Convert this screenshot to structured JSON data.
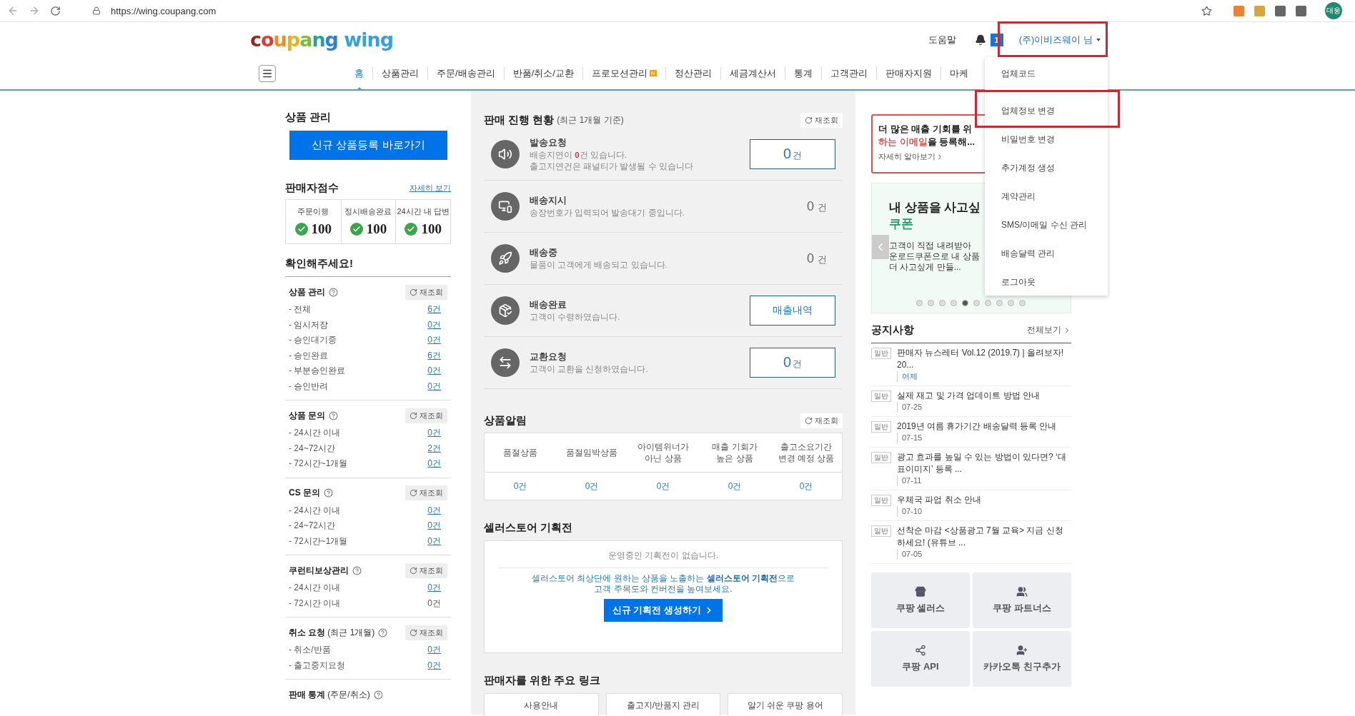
{
  "browser": {
    "url": "https://wing.coupang.com",
    "avatar": "대웅"
  },
  "header": {
    "logo": {
      "brand": "coupang",
      "product": "wing"
    },
    "help": "도움말",
    "notification_count": "1",
    "user": "(주)이비즈웨이 님"
  },
  "nav": [
    {
      "label": "홈",
      "selected": true
    },
    {
      "label": "상품관리",
      "selected": false
    },
    {
      "label": "주문/배송관리",
      "selected": false
    },
    {
      "label": "반품/취소/교환",
      "selected": false
    },
    {
      "label": "프로모션관리",
      "selected": false,
      "badge": "N"
    },
    {
      "label": "정산관리",
      "selected": false
    },
    {
      "label": "세금계산서",
      "selected": false
    },
    {
      "label": "통계",
      "selected": false
    },
    {
      "label": "고객관리",
      "selected": false
    },
    {
      "label": "판매자지원",
      "selected": false
    },
    {
      "label": "마케",
      "selected": false
    }
  ],
  "account_menu": [
    "업체코드",
    "업체정보 변경",
    "비밀번호 변경",
    "추가계정 생성",
    "계약관리",
    "SMS/이메일 수신 관리",
    "배송달력 관리",
    "로그아웃"
  ],
  "left": {
    "product_title": "상품 관리",
    "register_button": "신규 상품등록 바로가기",
    "score": {
      "title": "판매자점수",
      "link": "자세히 보기",
      "metrics": [
        {
          "label": "주문이행",
          "value": "100"
        },
        {
          "label": "정시배송완료",
          "value": "100"
        },
        {
          "label": "24시간 내 답변",
          "value": "100"
        }
      ]
    },
    "check_title": "확인해주세요!",
    "sections": [
      {
        "title": "상품 관리",
        "refresh": "재조회",
        "items": [
          {
            "label": "- 전체",
            "count": "6건",
            "link": true
          },
          {
            "label": "- 임시저장",
            "count": "0건",
            "link": true
          },
          {
            "label": "- 승인대기중",
            "count": "0건",
            "link": true
          },
          {
            "label": "- 승인완료",
            "count": "6건",
            "link": true
          },
          {
            "label": "- 부분승인완료",
            "count": "0건",
            "link": true
          },
          {
            "label": "- 승인반려",
            "count": "0건",
            "link": true
          }
        ]
      },
      {
        "title": "상품 문의",
        "refresh": "재조회",
        "items": [
          {
            "label": "- 24시간 이내",
            "count": "0건",
            "link": true
          },
          {
            "label": "- 24~72시간",
            "count": "2건",
            "link": true
          },
          {
            "label": "- 72시간~1개월",
            "count": "0건",
            "link": true
          }
        ]
      },
      {
        "title": "CS 문의",
        "refresh": "재조회",
        "items": [
          {
            "label": "- 24시간 이내",
            "count": "0건",
            "link": true
          },
          {
            "label": "- 24~72시간",
            "count": "0건",
            "link": true
          },
          {
            "label": "- 72시간~1개월",
            "count": "0건",
            "link": true
          }
        ]
      },
      {
        "title": "쿠런티보상관리",
        "refresh": "재조회",
        "items": [
          {
            "label": "- 24시간 이내",
            "count": "0건",
            "link": true
          },
          {
            "label": "- 72시간 이내",
            "count": "0건",
            "link": false
          }
        ]
      },
      {
        "title": "취소 요청",
        "note": "(최근 1개월)",
        "refresh": "재조회",
        "items": [
          {
            "label": "- 취소/반품",
            "count": "0건",
            "link": true
          },
          {
            "label": "- 출고중지요청",
            "count": "0건",
            "link": true
          }
        ]
      },
      {
        "title": "판매 통계",
        "note": "(주문/취소)"
      }
    ]
  },
  "middle": {
    "status": {
      "title": "판매 진행 현황",
      "note": "(최근 1개월 기준)",
      "refresh": "재조회",
      "rows": [
        {
          "kind": "boxed",
          "title": "발송요청",
          "lines": [
            "배송지연이 **0**건 있습니다.",
            "출고지연건은 패널티가 발생될 수 있습니다"
          ],
          "count": "0",
          "unit": "건"
        },
        {
          "kind": "plain",
          "title": "배송지시",
          "lines": [
            "송장번호가 입력되어 발송대기 중입니다."
          ],
          "count": "0",
          "unit": "건"
        },
        {
          "kind": "plain",
          "title": "배송중",
          "lines": [
            "물품이 고객에게 배송되고 있습니다."
          ],
          "count": "0",
          "unit": "건"
        },
        {
          "kind": "button",
          "title": "배송완료",
          "lines": [
            "고객이 수령하였습니다."
          ],
          "label": "매출내역"
        },
        {
          "kind": "boxed",
          "title": "교환요청",
          "lines": [
            "고객이 교환을 신청하였습니다."
          ],
          "count": "0",
          "unit": "건"
        }
      ]
    },
    "alerts": {
      "title": "상품알림",
      "refresh": "재조회",
      "columns": [
        "품절상품",
        "품절임박상품",
        "아이템위너가\n아닌 상품",
        "매출 기회가\n높은 상품",
        "출고소요기간\n변경 예정 상품"
      ],
      "values": [
        "0건",
        "0건",
        "0건",
        "0건",
        "0건"
      ]
    },
    "promotion": {
      "title": "셀러스토어 기획전",
      "empty": "운영중인 기획전이 없습니다.",
      "message": "셀러스토어 최상단에 원하는 상품을 노출하는 **셀러스토어 기획전**으로",
      "message_2": "고객 주목도와 컨버전을 높여보세요.",
      "button": "신규 기획전 생성하기"
    },
    "links": {
      "title": "판매자를 위한 주요 링크",
      "items": [
        "사용안내",
        "출고지/반품지 관리",
        "알기 쉬운 쿠팡 용어"
      ]
    }
  },
  "right": {
    "banner": {
      "line_1": "더 많은 매출 기회를 위",
      "highlight": "하는 이메일",
      "rest": "을 등록해...",
      "link": "자세히 알아보기"
    },
    "carousel": {
      "title": "내 상품을 사고싶",
      "subtitle": "쿠폰",
      "lines": [
        "고객이 직접 내려받아",
        "운로드쿠폰으로 내 상품",
        "더 사고싶게 만들..."
      ],
      "dots": [
        {
          "selected": false
        },
        {
          "selected": false
        },
        {
          "selected": false
        },
        {
          "selected": false
        },
        {
          "selected": true
        },
        {
          "selected": false
        },
        {
          "selected": false
        },
        {
          "selected": false
        },
        {
          "selected": false
        },
        {
          "selected": false
        }
      ]
    },
    "notices": {
      "title": "공지사항",
      "more": "전체보기",
      "items": [
        {
          "tag": "일반",
          "title": "판매자 뉴스레터 Vol.12 (2019.7) | 올려보자! 20...",
          "date": "어제",
          "recent": true
        },
        {
          "tag": "일반",
          "title": "실제 재고 및 가격 업데이트 방법 안내",
          "date": "07-25",
          "recent": false
        },
        {
          "tag": "일반",
          "title": "2019년 여름 휴가기간 배송달력 등록 안내",
          "date": "07-15",
          "recent": false
        },
        {
          "tag": "일반",
          "title": "광고 효과를 높일 수 있는 방법이 있다면? ‘대표이미지’ 등록 ...",
          "date": "07-11",
          "recent": false
        },
        {
          "tag": "일반",
          "title": "우체국 파업 취소 안내",
          "date": "07-10",
          "recent": false
        },
        {
          "tag": "일반",
          "title": "선착순 마감 <상품광고 7월 교육> 지금 신청하세요! (유튜브 ...",
          "date": "07-05",
          "recent": false
        }
      ]
    },
    "tiles": [
      "쿠팡 셀러스",
      "쿠팡 파트너스",
      "쿠팡 API",
      "카카오톡 친구추가"
    ]
  }
}
